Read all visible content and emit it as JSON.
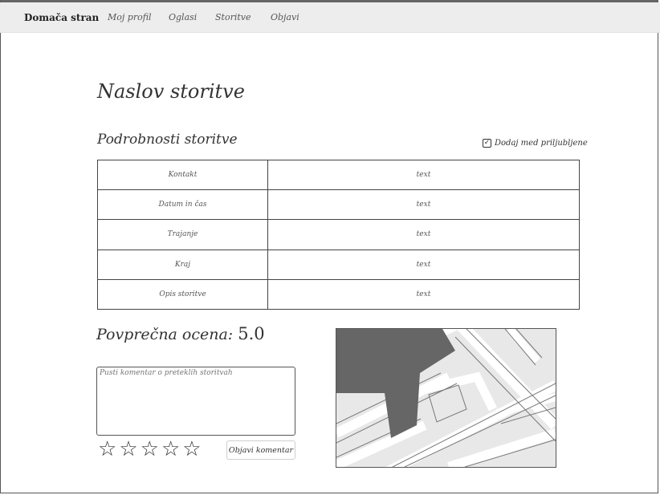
{
  "nav": {
    "brand": "Domača stran",
    "items": [
      "Moj profil",
      "Oglasi",
      "Storitve",
      "Objavi"
    ]
  },
  "page_title": "Naslov storitve",
  "details": {
    "title": "Podrobnosti storitve",
    "favorite": {
      "label": "Dodaj med priljubljene",
      "checked": true
    },
    "rows": [
      {
        "label": "Kontakt",
        "value": "text"
      },
      {
        "label": "Datum in čas",
        "value": "text"
      },
      {
        "label": "Trajanje",
        "value": "text"
      },
      {
        "label": "Kraj",
        "value": "text"
      },
      {
        "label": "Opis storitve",
        "value": "text"
      }
    ]
  },
  "rating": {
    "label": "Povprečna ocena:",
    "value": "5.0",
    "stars": 5,
    "filled": 0
  },
  "comment": {
    "placeholder": "Pusti komentar o preteklih storitvah",
    "value": ""
  },
  "post_button": "Objavi komentar",
  "icons": {
    "check": "check-icon",
    "star": "star-outline-icon",
    "map": "map-image"
  },
  "colors": {
    "navbar": "#ededed",
    "border": "#444444",
    "map_block": "#666666",
    "map_bg": "#e8e8e8"
  }
}
